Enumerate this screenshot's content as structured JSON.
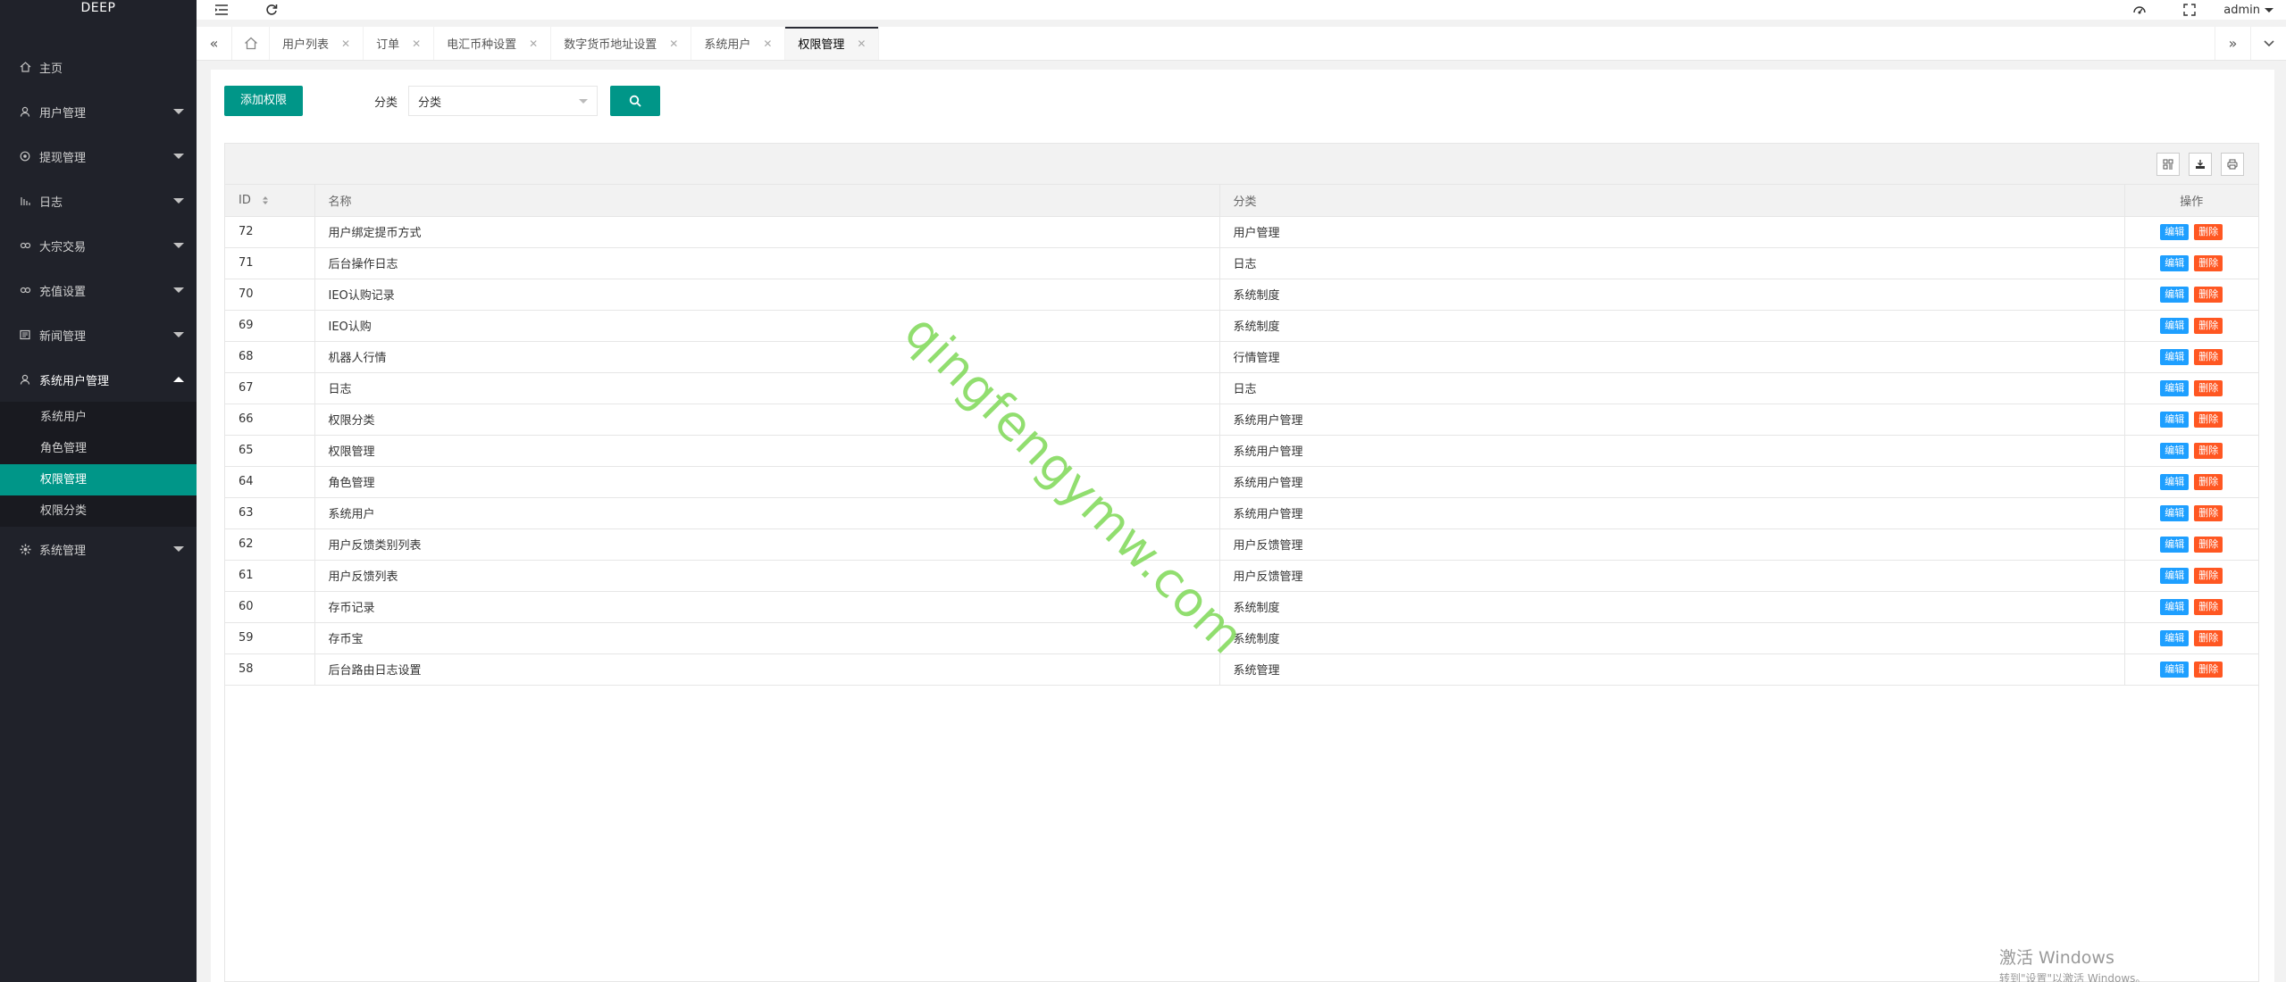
{
  "brand": "DEEP",
  "sidebar": {
    "items": [
      {
        "label": "主页",
        "icon": "home-icon"
      },
      {
        "label": "用户管理",
        "icon": "user-icon"
      },
      {
        "label": "提现管理",
        "icon": "settings-icon"
      },
      {
        "label": "日志",
        "icon": "list-icon"
      },
      {
        "label": "大宗交易",
        "icon": "link-icon"
      },
      {
        "label": "充值设置",
        "icon": "link-icon"
      },
      {
        "label": "新闻管理",
        "icon": "news-icon"
      },
      {
        "label": "系统用户管理",
        "icon": "user-icon"
      },
      {
        "label": "系统管理",
        "icon": "gear-icon"
      }
    ],
    "sub_items": [
      "系统用户",
      "角色管理",
      "权限管理",
      "权限分类"
    ]
  },
  "header": {
    "user": "admin"
  },
  "tabs": [
    "用户列表",
    "订单",
    "电汇币种设置",
    "数字货币地址设置",
    "系统用户",
    "权限管理"
  ],
  "toolbar": {
    "add_label": "添加权限",
    "filter_label": "分类",
    "select_value": "分类"
  },
  "table": {
    "columns": [
      "ID",
      "名称",
      "分类",
      "操作"
    ],
    "edit_label": "编辑",
    "delete_label": "删除",
    "rows": [
      {
        "id": "72",
        "name": "用户绑定提币方式",
        "category": "用户管理"
      },
      {
        "id": "71",
        "name": "后台操作日志",
        "category": "日志"
      },
      {
        "id": "70",
        "name": "IEO认购记录",
        "category": "系统制度"
      },
      {
        "id": "69",
        "name": "IEO认购",
        "category": "系统制度"
      },
      {
        "id": "68",
        "name": "机器人行情",
        "category": "行情管理"
      },
      {
        "id": "67",
        "name": "日志",
        "category": "日志"
      },
      {
        "id": "66",
        "name": "权限分类",
        "category": "系统用户管理"
      },
      {
        "id": "65",
        "name": "权限管理",
        "category": "系统用户管理"
      },
      {
        "id": "64",
        "name": "角色管理",
        "category": "系统用户管理"
      },
      {
        "id": "63",
        "name": "系统用户",
        "category": "系统用户管理"
      },
      {
        "id": "62",
        "name": "用户反馈类别列表",
        "category": "用户反馈管理"
      },
      {
        "id": "61",
        "name": "用户反馈列表",
        "category": "用户反馈管理"
      },
      {
        "id": "60",
        "name": "存币记录",
        "category": "系统制度"
      },
      {
        "id": "59",
        "name": "存币宝",
        "category": "系统制度"
      },
      {
        "id": "58",
        "name": "后台路由日志设置",
        "category": "系统管理"
      }
    ]
  },
  "watermark": "qingfengymw.com",
  "activation": {
    "line1": "激活 Windows",
    "line2": "转到\"设置\"以激活 Windows。"
  }
}
